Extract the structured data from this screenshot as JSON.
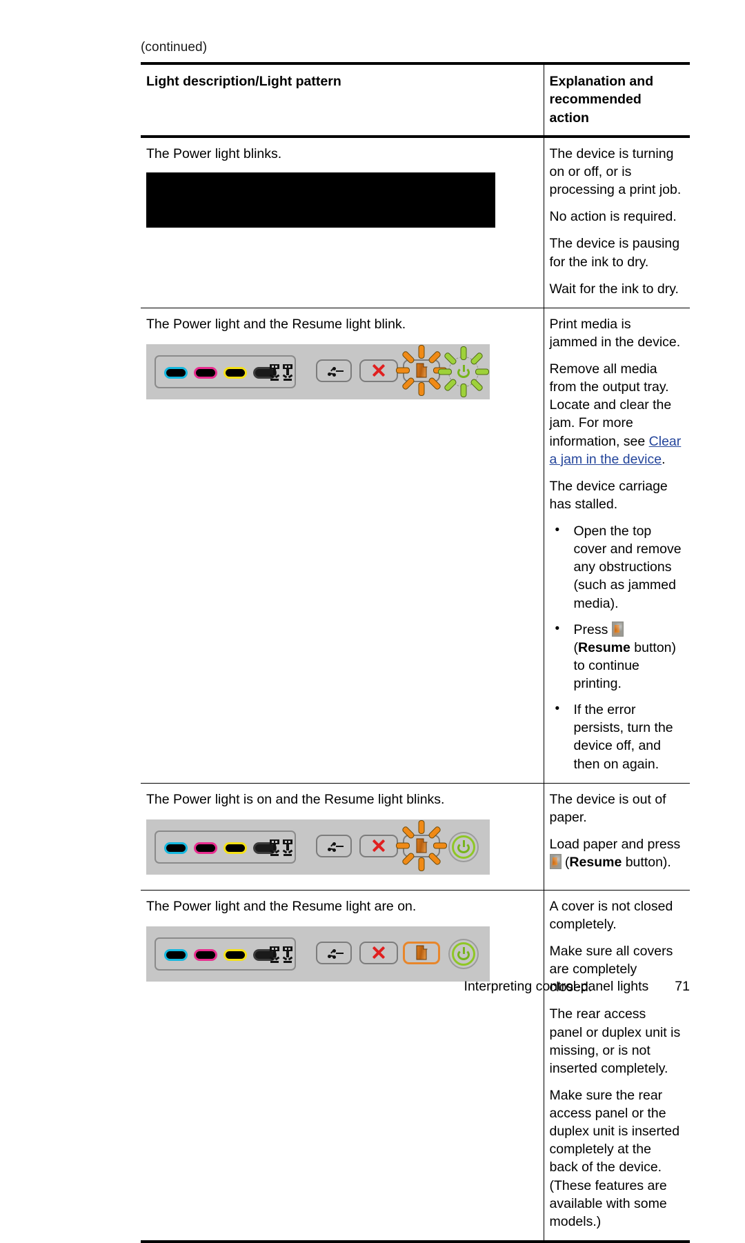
{
  "page": {
    "continued_label": "(continued)",
    "footer_title": "Interpreting control-panel lights",
    "page_number": "71"
  },
  "table": {
    "headers": {
      "col1": "Light description/Light pattern",
      "col2": "Explanation and recommended action"
    },
    "rows": [
      {
        "description": "The Power light blinks.",
        "panel": {
          "type": "redacted-image",
          "ink_labels": [],
          "buttons": [],
          "power_light": "",
          "resume_light": ""
        },
        "explanation": [
          "The device is turning on or off, or is processing a print job.",
          "No action is required.",
          "The device is pausing for the ink to dry.",
          "Wait for the ink to dry."
        ]
      },
      {
        "description": "The Power light and the Resume light blink.",
        "panel": {
          "type": "control-panel",
          "ink_labels": [
            "cyan",
            "magenta",
            "yellow",
            "black"
          ],
          "printheads": 2,
          "buttons": [
            "network-button",
            "cancel-button",
            "resume-button"
          ],
          "power_light": "blinking",
          "resume_light": "blinking"
        },
        "explanation": [
          "Print media is jammed in the device.",
          "Remove all media from the output tray. Locate and clear the jam. For more information, see ",
          "The device carriage has stalled."
        ],
        "link_text": "Clear a jam in the device",
        "link_trailing": ".",
        "bullets": [
          "Open the top cover and remove any obstructions (such as jammed media).",
          "Press",
          "If the error persists, turn the device off, and then on again."
        ],
        "bullet2_suffix_bold": "Resume",
        "bullet2_suffix_rest": " button) to continue printing."
      },
      {
        "description": "The Power light is on and the Resume light blinks.",
        "panel": {
          "type": "control-panel",
          "ink_labels": [
            "cyan",
            "magenta",
            "yellow",
            "black"
          ],
          "printheads": 2,
          "buttons": [
            "network-button",
            "cancel-button",
            "resume-button"
          ],
          "power_light": "on",
          "resume_light": "blinking"
        },
        "explanation": [
          "The device is out of paper.",
          "Load paper and press"
        ],
        "load_suffix_bold": "Resume",
        "load_suffix_rest": " button)."
      },
      {
        "description": "The Power light and the Resume light are on.",
        "panel": {
          "type": "control-panel",
          "ink_labels": [
            "cyan",
            "magenta",
            "yellow",
            "black"
          ],
          "printheads": 2,
          "buttons": [
            "network-button",
            "cancel-button",
            "resume-button"
          ],
          "power_light": "on",
          "resume_light": "on"
        },
        "explanation": [
          "A cover is not closed completely.",
          "Make sure all covers are completely closed.",
          "The rear access panel or duplex unit is missing, or is not inserted completely.",
          "Make sure the rear access panel or the duplex unit is inserted completely at the back of the device. (These features are available with some models.)"
        ]
      }
    ]
  },
  "colors": {
    "link": "#24459b",
    "panel_background": "#c6c6c6",
    "resume_orange": "#f08a16",
    "power_green": "#9ed13a",
    "cancel_red": "#e02020",
    "ink_cyan": "#16b8df",
    "ink_magenta": "#e82d8f",
    "ink_yellow": "#f5e117",
    "ink_black": "#1a1a1a"
  }
}
